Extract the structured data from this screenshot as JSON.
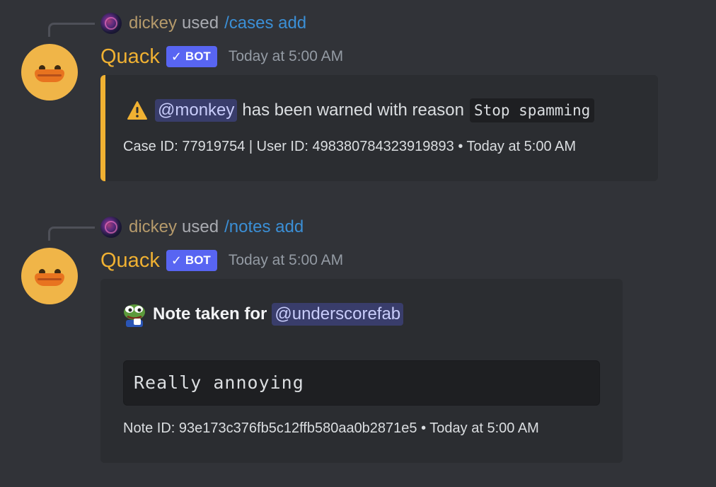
{
  "messages": [
    {
      "reply": {
        "user": "dickey",
        "used": "used",
        "command": "/cases add"
      },
      "author": "Quack",
      "bot_tag": "BOT",
      "timestamp": "Today at 5:00 AM",
      "embed": {
        "accent_color": "#f0b132",
        "icon": "warning-icon",
        "mention": "@monkey",
        "text": "has been warned with reason",
        "reason": "Stop spamming",
        "footer": "Case ID: 77919754 | User ID: 498380784323919893 • Today at 5:00 AM"
      }
    },
    {
      "reply": {
        "user": "dickey",
        "used": "used",
        "command": "/notes add"
      },
      "author": "Quack",
      "bot_tag": "BOT",
      "timestamp": "Today at 5:00 AM",
      "embed": {
        "icon": "pepe-emoji-icon",
        "title": "Note taken for",
        "mention": "@underscorefab",
        "code": "Really annoying",
        "footer": "Note ID: 93e173c376fb5c12ffb580aa0b2871e5 • Today at 5:00 AM"
      }
    }
  ],
  "colors": {
    "background": "#313338",
    "embed_background": "#2b2d31",
    "username": "#f0b132",
    "bot_tag": "#5865f2",
    "command_link": "#3b8fd6"
  }
}
